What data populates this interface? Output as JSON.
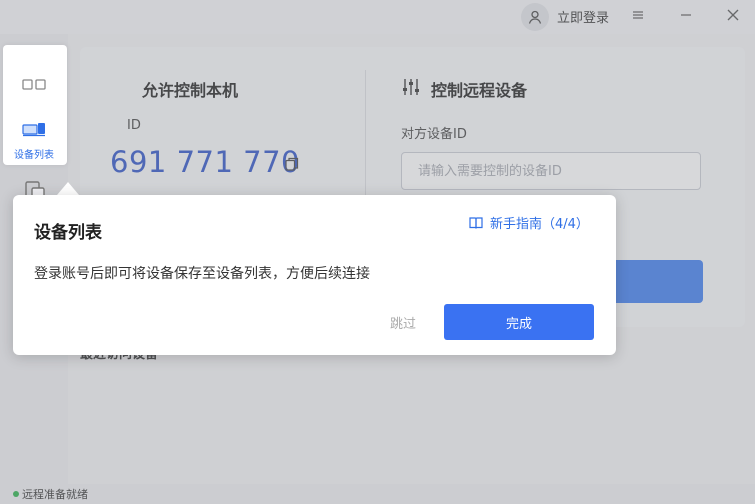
{
  "header": {
    "login_label": "立即登录"
  },
  "sidebar": {
    "items": [
      {
        "label": ""
      },
      {
        "label": "设备列表"
      },
      {
        "label": ""
      }
    ]
  },
  "local": {
    "title": "允许控制本机",
    "id_label": "ID",
    "device_id": "691 771 770"
  },
  "remote": {
    "title": "控制远程设备",
    "id_label": "对方设备ID",
    "input_value": "",
    "input_placeholder": "请输入需要控制的设备ID"
  },
  "recent": {
    "label": "最近访问设备"
  },
  "status": {
    "text": "远程准备就绪",
    "color": "#2bb24c"
  },
  "tooltip": {
    "title": "设备列表",
    "guide_label": "新手指南（4/4）",
    "body": "登录账号后即可将设备保存至设备列表，方便后续连接",
    "skip_label": "跳过",
    "done_label": "完成"
  },
  "colors": {
    "accent": "#3a72f2",
    "id_blue": "#2f54c8"
  }
}
